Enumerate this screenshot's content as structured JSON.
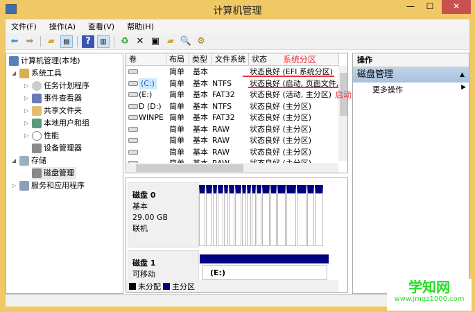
{
  "window": {
    "title": "计算机管理",
    "minimize": "—",
    "maximize": "☐",
    "close": "✕"
  },
  "menu": [
    "文件(F)",
    "操作(A)",
    "查看(V)",
    "帮助(H)"
  ],
  "toolbar": [
    "back-icon",
    "forward-icon",
    "up-icon",
    "show-hide-tree-icon",
    "help-icon",
    "show-hide-action-icon",
    "refresh-icon",
    "delete-icon",
    "properties-icon",
    "open-icon",
    "search-icon",
    "settings-icon"
  ],
  "tree": {
    "root": "计算机管理(本地)",
    "items": [
      {
        "label": "系统工具",
        "level": 1,
        "expanded": true
      },
      {
        "label": "任务计划程序",
        "level": 2,
        "expandable": true
      },
      {
        "label": "事件查看器",
        "level": 2,
        "expandable": true
      },
      {
        "label": "共享文件夹",
        "level": 2,
        "expandable": true
      },
      {
        "label": "本地用户和组",
        "level": 2,
        "expandable": true
      },
      {
        "label": "性能",
        "level": 2,
        "expandable": true
      },
      {
        "label": "设备管理器",
        "level": 2,
        "expandable": false
      },
      {
        "label": "存储",
        "level": 1,
        "expanded": true
      },
      {
        "label": "磁盘管理",
        "level": 2,
        "expandable": false,
        "selected": true
      },
      {
        "label": "服务和应用程序",
        "level": 1,
        "expandable": true
      }
    ]
  },
  "table": {
    "headers": [
      "卷",
      "布局",
      "类型",
      "文件系统",
      "状态"
    ],
    "rows": [
      [
        "",
        "简单",
        "基本",
        "",
        "状态良好 (EFI 系统分区)"
      ],
      [
        "(C:)",
        "简单",
        "基本",
        "NTFS",
        "状态良好 (启动, 页面文件,"
      ],
      [
        "(E:)",
        "简单",
        "基本",
        "FAT32",
        "状态良好 (活动, 主分区)"
      ],
      [
        "D (D:)",
        "简单",
        "基本",
        "NTFS",
        "状态良好 (主分区)"
      ],
      [
        "WINPE",
        "简单",
        "基本",
        "FAT32",
        "状态良好 (主分区)"
      ],
      [
        "",
        "简单",
        "基本",
        "RAW",
        "状态良好 (主分区)"
      ],
      [
        "",
        "简单",
        "基本",
        "RAW",
        "状态良好 (主分区)"
      ],
      [
        "",
        "简单",
        "基本",
        "RAW",
        "状态良好 (主分区)"
      ],
      [
        "",
        "简单",
        "基本",
        "RAW",
        "状态良好 (主分区)"
      ]
    ]
  },
  "annotations": {
    "system_partition": "系统分区",
    "boot_partition": "启动分区",
    "color": "#f0303a"
  },
  "disks": [
    {
      "name": "磁盘 0",
      "type": "基本",
      "size": "29.00 GB",
      "state": "联机"
    },
    {
      "name": "磁盘 1",
      "type": "可移动",
      "partition": "(E:)"
    }
  ],
  "legend": [
    {
      "label": "未分配",
      "color": "#000000"
    },
    {
      "label": "主分区",
      "color": "#000080"
    }
  ],
  "actions": {
    "header": "操作",
    "section": "磁盘管理",
    "items": [
      "更多操作"
    ]
  },
  "watermark": {
    "logo": "学知网",
    "url": "www.jmqz1000.com"
  }
}
